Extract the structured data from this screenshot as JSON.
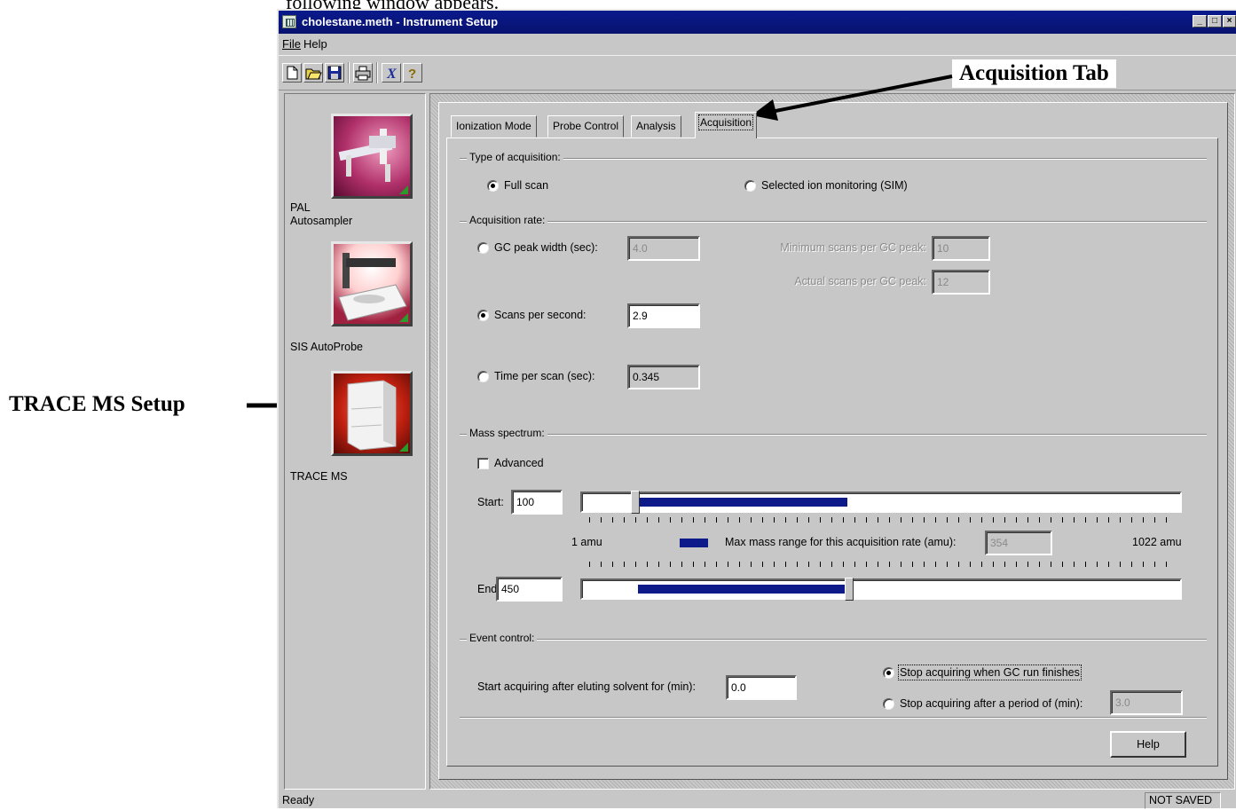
{
  "document": {
    "intro_text": "following window appears.",
    "callouts": {
      "acquisition_tab": "Acquisition Tab",
      "trace_ms_setup": "TRACE MS Setup"
    }
  },
  "window": {
    "title": "cholestane.meth - Instrument Setup",
    "controls": {
      "minimize": "_",
      "maximize": "□",
      "close": "×"
    }
  },
  "menu": {
    "file": "File",
    "help": "Help"
  },
  "toolbar": {
    "buttons": [
      "new-icon",
      "open-icon",
      "save-icon",
      "print-icon",
      "cut-icon",
      "about-help-icon"
    ]
  },
  "sidebar": {
    "items": [
      {
        "label": "PAL\nAutosampler",
        "icon": "pal-autosampler-icon"
      },
      {
        "label": "SIS AutoProbe",
        "icon": "sis-autoprobe-icon"
      },
      {
        "label": "TRACE MS",
        "icon": "trace-ms-icon"
      }
    ]
  },
  "tabs": [
    {
      "label": "Ionization Mode",
      "active": false
    },
    {
      "label": "Probe Control",
      "active": false
    },
    {
      "label": "Analysis",
      "active": false
    },
    {
      "label": "Acquisition",
      "active": true
    }
  ],
  "acquisition_type": {
    "group_label": "Type of acquisition:",
    "full_scan": {
      "label": "Full scan",
      "selected": true
    },
    "sim": {
      "label": "Selected ion monitoring (SIM)",
      "selected": false
    }
  },
  "acquisition_rate": {
    "group_label": "Acquisition rate:",
    "gc_peak_width": {
      "label": "GC peak width (sec):",
      "value": "4.0",
      "selected": false
    },
    "min_scans_per_peak": {
      "label": "Minimum scans per GC peak:",
      "value": "10"
    },
    "actual_scans_per_peak": {
      "label": "Actual scans per GC peak:",
      "value": "12"
    },
    "scans_per_second": {
      "label": "Scans per second:",
      "value": "2.9",
      "selected": true
    },
    "time_per_scan": {
      "label": "Time per scan (sec):",
      "value": "0.345",
      "selected": false
    }
  },
  "mass_spectrum": {
    "group_label": "Mass spectrum:",
    "advanced": {
      "label": "Advanced",
      "checked": false
    },
    "start": {
      "label": "Start:",
      "value": "100"
    },
    "end": {
      "label": "End:",
      "value": "450"
    },
    "min_label": "1 amu",
    "max_label": "1022 amu",
    "max_range_label": "Max mass range for this acquisition rate (amu):",
    "max_range_value": "354",
    "range_min_amu": 1,
    "range_max_amu": 1022,
    "start_slider": {
      "fill_start_amu": 100,
      "fill_end_amu": 454
    },
    "end_slider": {
      "fill_start_amu": 96,
      "fill_end_amu": 450
    }
  },
  "event_control": {
    "group_label": "Event control:",
    "start_after_label": "Start acquiring after eluting solvent for (min):",
    "start_after_value": "0.0",
    "stop_when_gc_finishes": {
      "label": "Stop acquiring when GC run finishes",
      "selected": true
    },
    "stop_after_period": {
      "label": "Stop acquiring after a period of (min):",
      "value": "3.0",
      "selected": false
    }
  },
  "help_button": "Help",
  "status": {
    "left": "Ready",
    "right": "NOT SAVED"
  },
  "colors": {
    "titlebar": "#0a1a8c",
    "slider_fill": "#0c1a8a",
    "face": "#c7c7c7"
  }
}
